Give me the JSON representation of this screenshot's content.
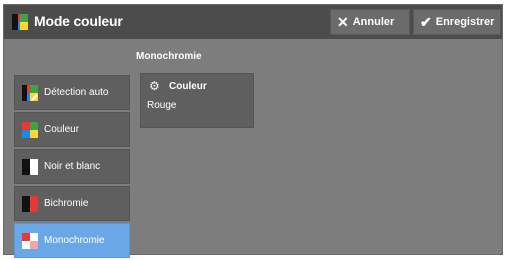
{
  "header": {
    "title": "Mode couleur",
    "cancel_label": "Annuler",
    "save_label": "Enregistrer",
    "icon": "color-mode-icon"
  },
  "section": {
    "title": "Monochromie"
  },
  "sidebar": {
    "items": [
      {
        "label": "Détection auto",
        "icon": "auto-detect-icon"
      },
      {
        "label": "Couleur",
        "icon": "color-icon"
      },
      {
        "label": "Noir et blanc",
        "icon": "black-white-icon"
      },
      {
        "label": "Bichromie",
        "icon": "two-color-icon"
      },
      {
        "label": "Monochromie",
        "icon": "monochrome-icon",
        "selected": true
      }
    ]
  },
  "option": {
    "label": "Couleur",
    "value": "Rouge",
    "icon": "gear-icon"
  },
  "colors": {
    "selected": "#6aa7e6",
    "header": "#4c4c4c",
    "panel": "#7d7d7d"
  }
}
